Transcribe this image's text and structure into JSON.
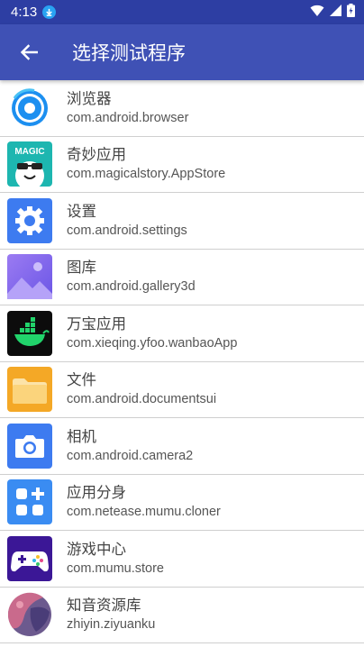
{
  "status": {
    "time": "4:13"
  },
  "appbar": {
    "title": "选择测试程序"
  },
  "apps": [
    {
      "name": "浏览器",
      "package": "com.android.browser"
    },
    {
      "name": "奇妙应用",
      "package": "com.magicalstory.AppStore",
      "icon_text": "MAGIC"
    },
    {
      "name": "设置",
      "package": "com.android.settings"
    },
    {
      "name": "图库",
      "package": "com.android.gallery3d"
    },
    {
      "name": "万宝应用",
      "package": "com.xieqing.yfoo.wanbaoApp"
    },
    {
      "name": "文件",
      "package": "com.android.documentsui"
    },
    {
      "name": "相机",
      "package": "com.android.camera2"
    },
    {
      "name": "应用分身",
      "package": "com.netease.mumu.cloner"
    },
    {
      "name": "游戏中心",
      "package": "com.mumu.store"
    },
    {
      "name": "知音资源库",
      "package": "zhiyin.ziyuanku"
    }
  ]
}
